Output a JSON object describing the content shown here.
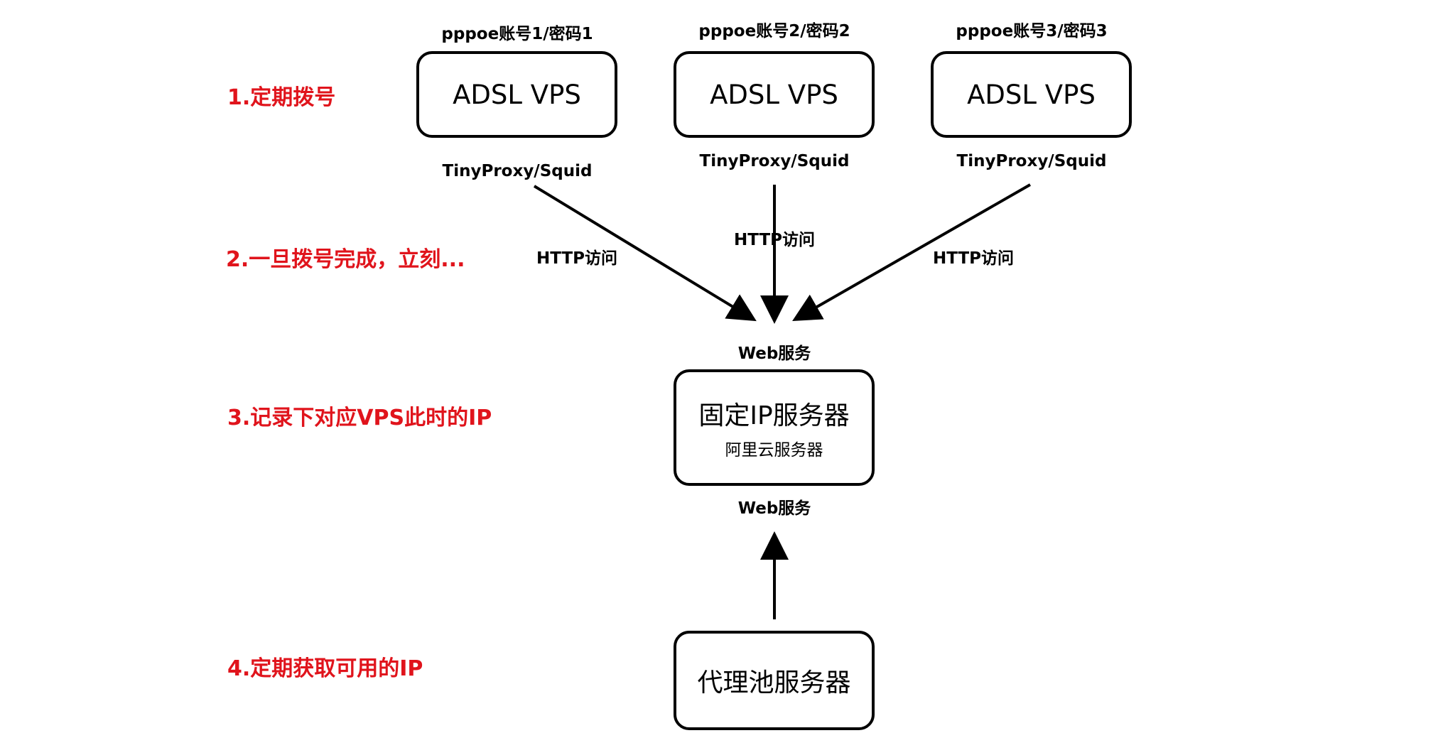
{
  "steps": {
    "s1": "1.定期拨号",
    "s2": "2.一旦拨号完成，立刻...",
    "s3": "3.记录下对应VPS此时的IP",
    "s4": "4.定期获取可用的IP"
  },
  "vps": [
    {
      "account": "pppoe账号1/密码1",
      "title": "ADSL VPS",
      "proxy": "TinyProxy/Squid"
    },
    {
      "account": "pppoe账号2/密码2",
      "title": "ADSL VPS",
      "proxy": "TinyProxy/Squid"
    },
    {
      "account": "pppoe账号3/密码3",
      "title": "ADSL VPS",
      "proxy": "TinyProxy/Squid"
    }
  ],
  "edges": {
    "http_left": "HTTP访问",
    "http_mid": "HTTP访问",
    "http_right": "HTTP访问"
  },
  "fixed_server": {
    "web_top": "Web服务",
    "title": "固定IP服务器",
    "subtitle": "阿里云服务器",
    "web_bottom": "Web服务"
  },
  "pool_server": {
    "title": "代理池服务器"
  },
  "colors": {
    "step_text": "#e0141c",
    "lines": "#000000"
  }
}
